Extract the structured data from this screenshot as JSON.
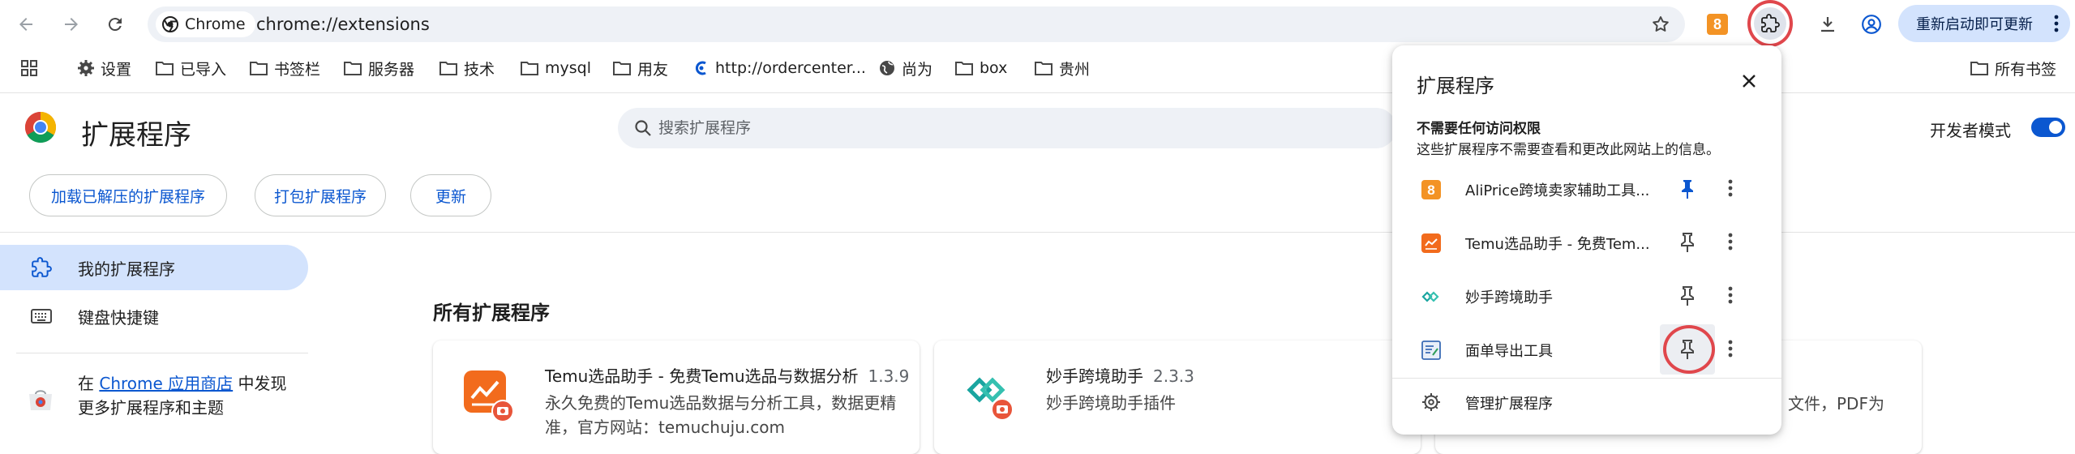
{
  "browser": {
    "chip_label": "Chrome",
    "url": "chrome://extensions",
    "ali_badge": "8",
    "restart_label": "重新启动即可更新"
  },
  "bookmarks": {
    "items": [
      {
        "label": "设置",
        "icon": "gear-icon"
      },
      {
        "label": "已导入",
        "icon": "folder-icon"
      },
      {
        "label": "书签栏",
        "icon": "folder-icon"
      },
      {
        "label": "服务器",
        "icon": "folder-icon"
      },
      {
        "label": "技术",
        "icon": "folder-icon"
      },
      {
        "label": "mysql",
        "icon": "folder-icon"
      },
      {
        "label": "用友",
        "icon": "folder-icon"
      },
      {
        "label": "http://ordercenter...",
        "icon": "site-icon"
      },
      {
        "label": "尚为",
        "icon": "globe-icon"
      },
      {
        "label": "box",
        "icon": "folder-icon"
      },
      {
        "label": "贵州",
        "icon": "folder-icon"
      }
    ],
    "all_bookmarks": "所有书签"
  },
  "page": {
    "title": "扩展程序",
    "search_placeholder": "搜索扩展程序",
    "dev_mode_label": "开发者模式",
    "dev_mode_on": true,
    "buttons": {
      "load_unpacked": "加载已解压的扩展程序",
      "pack": "打包扩展程序",
      "update": "更新"
    }
  },
  "sidebar": {
    "items": [
      {
        "label": "我的扩展程序",
        "icon": "puzzle-icon",
        "active": true
      },
      {
        "label": "键盘快捷键",
        "icon": "keyboard-icon",
        "active": false
      }
    ],
    "store_prefix": "在",
    "store_link": "Chrome 应用商店",
    "store_suffix": "中发现",
    "store_line2": "更多扩展程序和主题"
  },
  "main": {
    "section_title": "所有扩展程序",
    "cards": [
      {
        "name": "Temu选品助手 - 免费Temu选品与数据分析",
        "version": "1.3.9",
        "desc_line1": "永久免费的Temu选品数据与分析工具，数据更精",
        "desc_line2": "准，官方网站：temuchuju.com",
        "icon": "temu-chart-icon",
        "color": "#f26b1d"
      },
      {
        "name": "妙手跨境助手",
        "version": "2.3.3",
        "desc_line1": "妙手跨境助手插件",
        "icon": "miaoshou-icon",
        "color": "#1aa5a0"
      }
    ],
    "partial_right_text": "文件，PDF为"
  },
  "popup": {
    "title": "扩展程序",
    "subtitle": "不需要任何访问权限",
    "subdesc": "这些扩展程序不需要查看和更改此网站上的信息。",
    "items": [
      {
        "name": "AliPrice跨境卖家辅助工具...",
        "pinned": true,
        "icon": "aliprice-icon"
      },
      {
        "name": "Temu选品助手 - 免费Tem...",
        "pinned": false,
        "icon": "temu-chart-icon"
      },
      {
        "name": "妙手跨境助手",
        "pinned": false,
        "icon": "miaoshou-icon"
      },
      {
        "name": "面单导出工具",
        "pinned": false,
        "icon": "label-export-icon"
      }
    ],
    "manage_label": "管理扩展程序"
  },
  "colors": {
    "accent": "#0b57d0",
    "annotation_red": "#e0474c",
    "aliprice_orange": "#f39325",
    "temu_orange": "#f26b1d"
  }
}
